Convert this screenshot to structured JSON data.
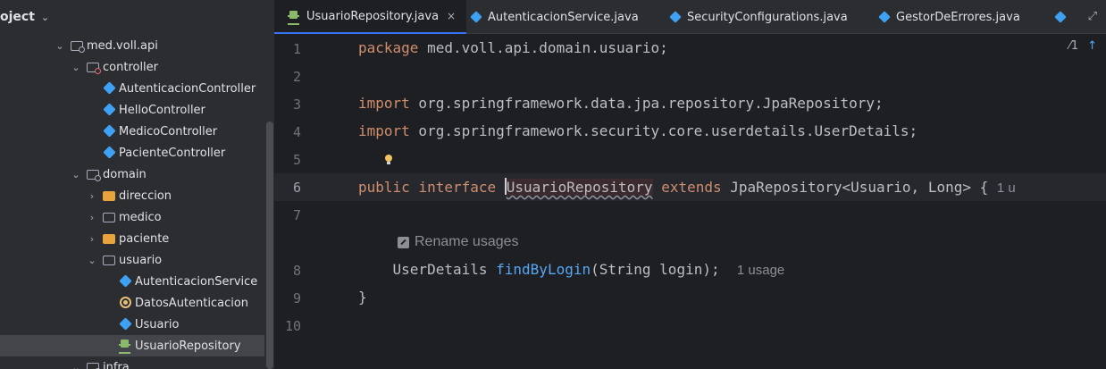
{
  "project": {
    "title": "oject",
    "items": [
      {
        "label": "med.voll.api",
        "depth": 0,
        "arrow": "expanded",
        "icon": "package-icon"
      },
      {
        "label": "controller",
        "depth": 1,
        "arrow": "expanded",
        "icon": "package-icon"
      },
      {
        "label": "AutenticacionController",
        "depth": 2,
        "arrow": "none",
        "icon": "class-icon"
      },
      {
        "label": "HelloController",
        "depth": 2,
        "arrow": "none",
        "icon": "class-icon"
      },
      {
        "label": "MedicoController",
        "depth": 2,
        "arrow": "none",
        "icon": "class-icon"
      },
      {
        "label": "PacienteController",
        "depth": 2,
        "arrow": "none",
        "icon": "class-icon"
      },
      {
        "label": "domain",
        "depth": 1,
        "arrow": "expanded",
        "icon": "package-icon"
      },
      {
        "label": "direccion",
        "depth": 2,
        "arrow": "collapsed",
        "icon": "folder-icon"
      },
      {
        "label": "medico",
        "depth": 2,
        "arrow": "collapsed",
        "icon": "folder-icon"
      },
      {
        "label": "paciente",
        "depth": 2,
        "arrow": "collapsed",
        "icon": "folder-icon"
      },
      {
        "label": "usuario",
        "depth": 2,
        "arrow": "expanded",
        "icon": "folder-icon"
      },
      {
        "label": "AutenticacionService",
        "depth": 3,
        "arrow": "none",
        "icon": "class-icon"
      },
      {
        "label": "DatosAutenticacion",
        "depth": 3,
        "arrow": "none",
        "icon": "record-icon"
      },
      {
        "label": "Usuario",
        "depth": 3,
        "arrow": "none",
        "icon": "class-icon"
      },
      {
        "label": "UsuarioRepository",
        "depth": 3,
        "arrow": "none",
        "icon": "interface-icon"
      },
      {
        "label": "infra",
        "depth": 1,
        "arrow": "expanded",
        "icon": "package-icon"
      }
    ]
  },
  "tabs": [
    {
      "label": "UsuarioRepository.java",
      "icon": "interface-icon",
      "active": true
    },
    {
      "label": "AutenticacionService.java",
      "icon": "class-icon",
      "active": false
    },
    {
      "label": "SecurityConfigurations.java",
      "icon": "class-icon",
      "active": false
    },
    {
      "label": "GestorDeErrores.java",
      "icon": "class-icon",
      "active": false
    }
  ],
  "tab_close": "×",
  "inspection": {
    "count": "1"
  },
  "code": {
    "line1": {
      "kw": "package",
      "rest": " med.voll.api.domain.usuario;"
    },
    "line3": {
      "kw": "import",
      "rest": " org.springframework.data.jpa.repository.JpaRepository;"
    },
    "line4": {
      "kw": "import",
      "rest": " org.springframework.security.core.userdetails.UserDetails;"
    },
    "line6": {
      "kw1": "public",
      "kw2": "interface",
      "name": "UsuarioRepository",
      "kw3": "extends",
      "rest": " JpaRepository<Usuario, Long> {",
      "hint": "1 u"
    },
    "rename_hint": "Rename usages",
    "line8": {
      "type": "UserDetails",
      "method": "findByLogin",
      "rest": "(String login);",
      "hint": "1 usage"
    },
    "line9": "}"
  },
  "line_numbers": [
    "1",
    "2",
    "3",
    "4",
    "5",
    "6",
    "7",
    "8",
    "9",
    "10"
  ]
}
